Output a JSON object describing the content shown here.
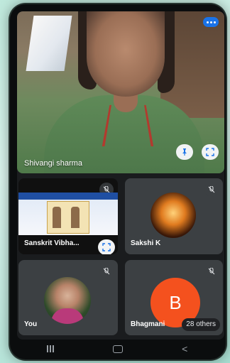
{
  "main_tile": {
    "participant_name": "Shivangi sharma",
    "speaking_indicator": "audio-active-icon",
    "pin_button_icon": "pin-icon",
    "fullscreen_button_icon": "fullscreen-icon"
  },
  "tiles": [
    {
      "participant_name": "Sanskrit Vibha...",
      "muted": true,
      "content": "shared-screen"
    },
    {
      "participant_name": "Sakshi K",
      "muted": true,
      "content": "profile-image"
    },
    {
      "participant_name": "You",
      "muted": true,
      "content": "profile-image"
    },
    {
      "participant_name": "Bhagmani",
      "muted": true,
      "avatar_letter": "B",
      "avatar_color": "#f4511e"
    }
  ],
  "others_count_label": "28 others",
  "colors": {
    "accent_blue": "#1a73e8",
    "tile_bg": "#3c4043",
    "background": "#1a1c1e"
  },
  "system_nav": {
    "recents_icon": "recents-icon",
    "home_icon": "home-icon",
    "back_icon": "back-icon",
    "back_glyph": "<"
  }
}
